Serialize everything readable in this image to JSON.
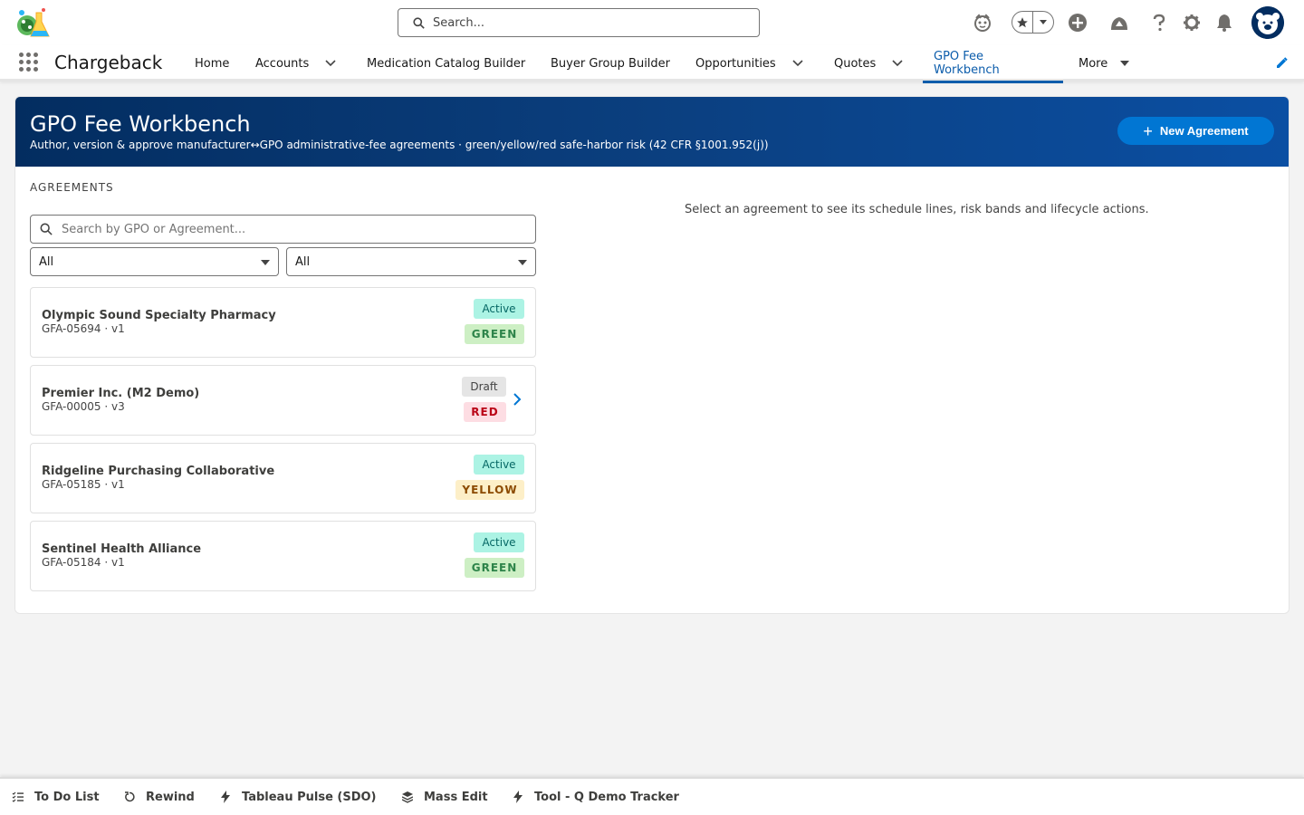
{
  "header": {
    "search_placeholder": "Search...",
    "icons": [
      "einstein-icon",
      "favorites-star-icon",
      "add-icon",
      "trailhead-icon",
      "help-icon",
      "setup-gear-icon",
      "notifications-bell-icon",
      "user-avatar"
    ]
  },
  "nav": {
    "app_name": "Chargeback",
    "items": [
      {
        "label": "Home",
        "has_menu": false
      },
      {
        "label": "Accounts",
        "has_menu": true
      },
      {
        "label": "Medication Catalog Builder",
        "has_menu": false
      },
      {
        "label": "Buyer Group Builder",
        "has_menu": false
      },
      {
        "label": "Opportunities",
        "has_menu": true
      },
      {
        "label": "Quotes",
        "has_menu": true
      },
      {
        "label": "GPO Fee Workbench",
        "has_menu": false,
        "active": true
      },
      {
        "label": "More",
        "has_menu": true
      }
    ]
  },
  "banner": {
    "title": "GPO Fee Workbench",
    "subtitle": "Author, version & approve manufacturer↔GPO administrative-fee agreements · green/yellow/red safe-harbor risk (42 CFR §1001.952(j))",
    "new_button_label": "New Agreement"
  },
  "agreements_panel": {
    "section_label": "AGREEMENTS",
    "search_placeholder": "Search by GPO or Agreement...",
    "filter_status_value": "All",
    "filter_risk_value": "All",
    "items": [
      {
        "name": "Olympic Sound Specialty Pharmacy",
        "id_version": "GFA-05694 · v1",
        "status": "Active",
        "risk": "GREEN"
      },
      {
        "name": "Premier Inc. (M2 Demo)",
        "id_version": "GFA-00005 · v3",
        "status": "Draft",
        "risk": "RED"
      },
      {
        "name": "Ridgeline Purchasing Collaborative",
        "id_version": "GFA-05185 · v1",
        "status": "Active",
        "risk": "YELLOW"
      },
      {
        "name": "Sentinel Health Alliance",
        "id_version": "GFA-05184 · v1",
        "status": "Active",
        "risk": "GREEN"
      }
    ]
  },
  "detail": {
    "empty_hint": "Select an agreement to see its schedule lines, risk bands and lifecycle actions."
  },
  "utility_bar": {
    "items": [
      {
        "label": "To Do List",
        "icon": "todo-list-icon"
      },
      {
        "label": "Rewind",
        "icon": "rewind-icon"
      },
      {
        "label": "Tableau Pulse (SDO)",
        "icon": "lightning-icon"
      },
      {
        "label": "Mass Edit",
        "icon": "layers-icon"
      },
      {
        "label": "Tool - Q Demo Tracker",
        "icon": "lightning-icon"
      }
    ]
  },
  "colors": {
    "brand_blue": "#0176d3",
    "banner_dark": "#032d60",
    "active_nav": "#0b5cab"
  }
}
